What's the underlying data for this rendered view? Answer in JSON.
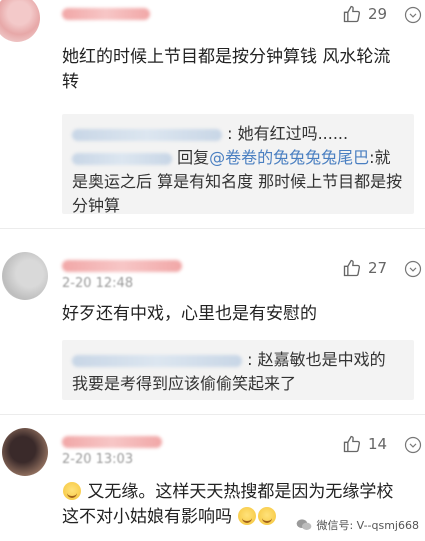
{
  "comments": [
    {
      "likes": "29",
      "text": "她红的时候上节目都是按分钟算钱 风水轮流转",
      "replies": [
        {
          "text": ": 她有红过吗......"
        },
        {
          "prefix": "回复",
          "mention": "@卷卷的兔兔兔兔尾巴",
          "text": ":就是奥运之后 算是有知名度 那时候上节目都是按分钟算"
        }
      ]
    },
    {
      "meta": "2-20 12:48",
      "likes": "27",
      "text": "好歹还有中戏，心里也是有安慰的",
      "replies": [
        {
          "text": ": 赵嘉敏也是中戏的 我要是考得到应该偷偷笑起来了"
        }
      ]
    },
    {
      "meta": "2-20 13:03",
      "likes": "14",
      "text_line1": "又无缘。这样天天热搜都是因为无缘学校",
      "text_line2": "这不对小姑娘有影响吗"
    }
  ],
  "watermark": "微信号: V--qsmj668",
  "icons": {
    "like": "thumbs-up-icon",
    "more": "chevron-down-circle-icon",
    "wechat": "wechat-icon"
  }
}
